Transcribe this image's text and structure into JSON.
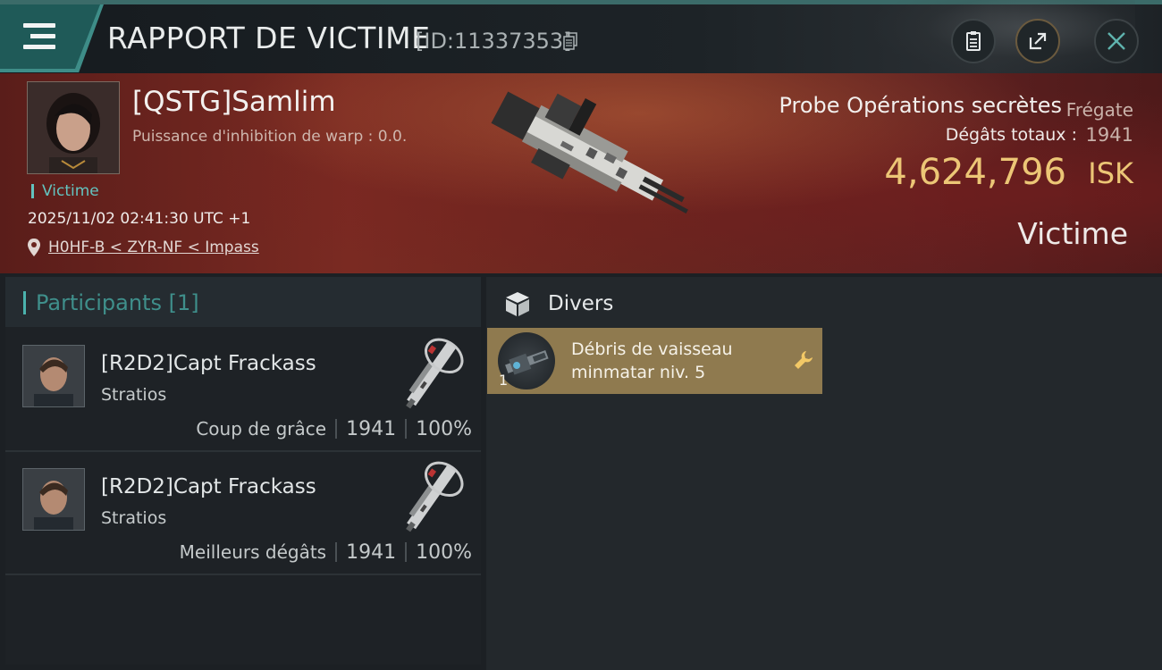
{
  "header": {
    "title": "RAPPORT DE VICTIME",
    "report_id": "[ID:11337353]"
  },
  "victim": {
    "name": "[QSTG]Samlim",
    "warp_disruption": "Puissance d'inhibition de warp : 0.0.",
    "tag": "Victime",
    "datetime": "2025/11/02 02:41:30 UTC +1",
    "location": "H0HF-B < ZYR-NF < Impass",
    "ship_name": "Probe Opérations secrètes",
    "ship_class": "Frégate",
    "damage_label": "Dégâts totaux :",
    "damage_total": "1941",
    "isk_value": "4,624,796",
    "isk_unit": "ISK",
    "role": "Victime"
  },
  "participants": {
    "title": "Participants [1]",
    "rows": [
      {
        "name": "[R2D2]Capt Frackass",
        "ship": "Stratios",
        "label": "Coup de grâce",
        "damage": "1941",
        "percent": "100%"
      },
      {
        "name": "[R2D2]Capt Frackass",
        "ship": "Stratios",
        "label": "Meilleurs dégâts",
        "damage": "1941",
        "percent": "100%"
      }
    ]
  },
  "divers": {
    "title": "Divers",
    "items": [
      {
        "name": "Débris de vaisseau minmatar niv. 5",
        "quantity": "1"
      }
    ]
  },
  "colors": {
    "accent": "#3e8d88",
    "isk_gold": "#ecc676",
    "banner_red": "#6a261f",
    "item_card": "#8f7a4f"
  }
}
